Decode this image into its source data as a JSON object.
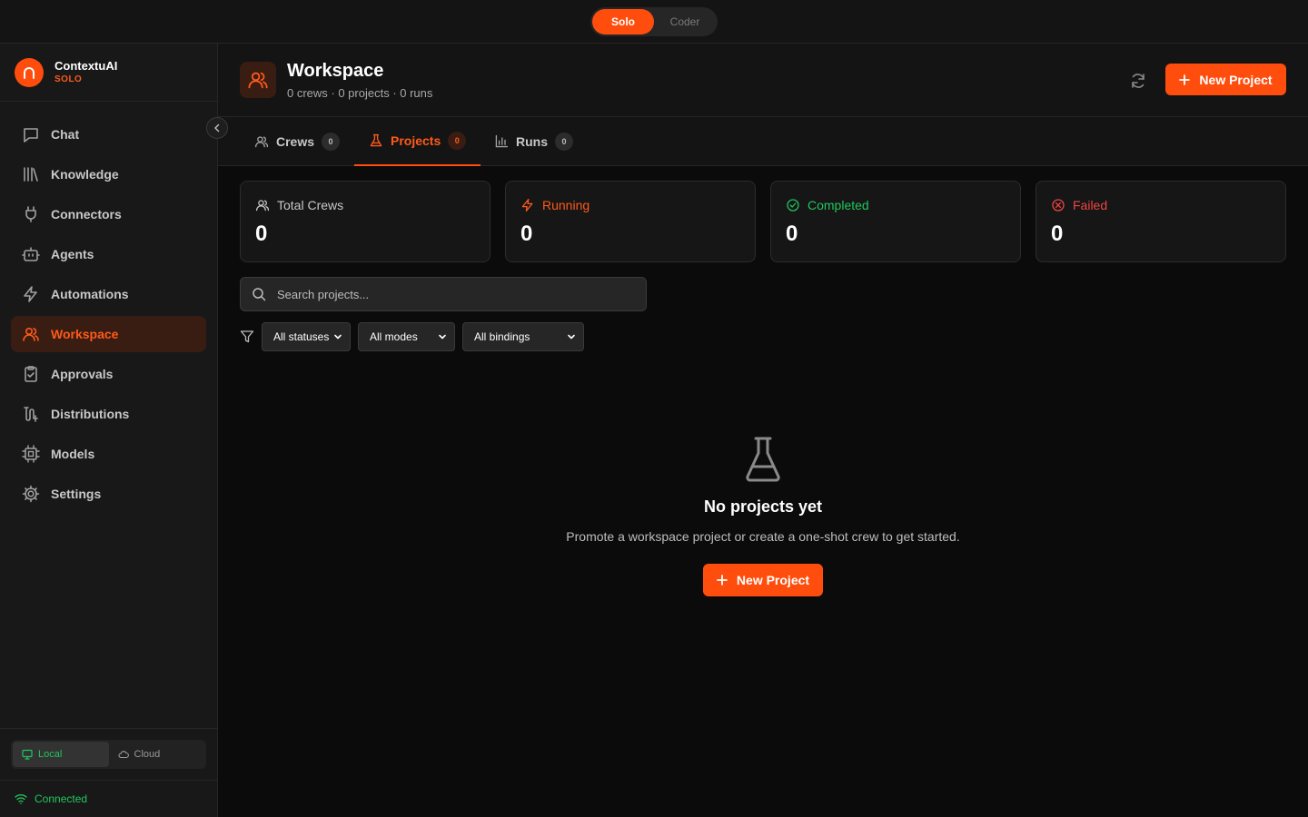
{
  "topbar": {
    "modes": [
      "Solo",
      "Coder"
    ],
    "active_mode": "Solo"
  },
  "brand": {
    "name": "ContextuAI",
    "mode": "SOLO"
  },
  "sidebar": {
    "items": [
      {
        "label": "Chat",
        "icon": "chat-icon"
      },
      {
        "label": "Knowledge",
        "icon": "library-icon"
      },
      {
        "label": "Connectors",
        "icon": "plug-icon"
      },
      {
        "label": "Agents",
        "icon": "bot-icon"
      },
      {
        "label": "Automations",
        "icon": "zap-icon"
      },
      {
        "label": "Workspace",
        "icon": "users-icon",
        "active": true
      },
      {
        "label": "Approvals",
        "icon": "clipboard-check-icon"
      },
      {
        "label": "Distributions",
        "icon": "route-icon"
      },
      {
        "label": "Models",
        "icon": "cpu-icon"
      },
      {
        "label": "Settings",
        "icon": "gear-icon"
      }
    ],
    "env": {
      "local": "Local",
      "cloud": "Cloud",
      "active": "Local"
    },
    "status": "Connected"
  },
  "header": {
    "title": "Workspace",
    "subtitle": "0 crews · 0 projects · 0 runs",
    "new_project": "New Project"
  },
  "tabs": [
    {
      "label": "Crews",
      "count": "0"
    },
    {
      "label": "Projects",
      "count": "0",
      "active": true
    },
    {
      "label": "Runs",
      "count": "0"
    }
  ],
  "stats": [
    {
      "label": "Total Crews",
      "value": "0",
      "color": "#c8c8c8"
    },
    {
      "label": "Running",
      "value": "0",
      "color": "#ff5a1a"
    },
    {
      "label": "Completed",
      "value": "0",
      "color": "#22c55e"
    },
    {
      "label": "Failed",
      "value": "0",
      "color": "#ef4444"
    }
  ],
  "search": {
    "placeholder": "Search projects..."
  },
  "filters": {
    "status": "All statuses",
    "mode": "All modes",
    "binding": "All bindings"
  },
  "empty": {
    "title": "No projects yet",
    "subtitle": "Promote a workspace project or create a one-shot crew to get started.",
    "button": "New Project"
  },
  "colors": {
    "accent": "#ff4d0d",
    "success": "#22c55e",
    "danger": "#ef4444"
  }
}
